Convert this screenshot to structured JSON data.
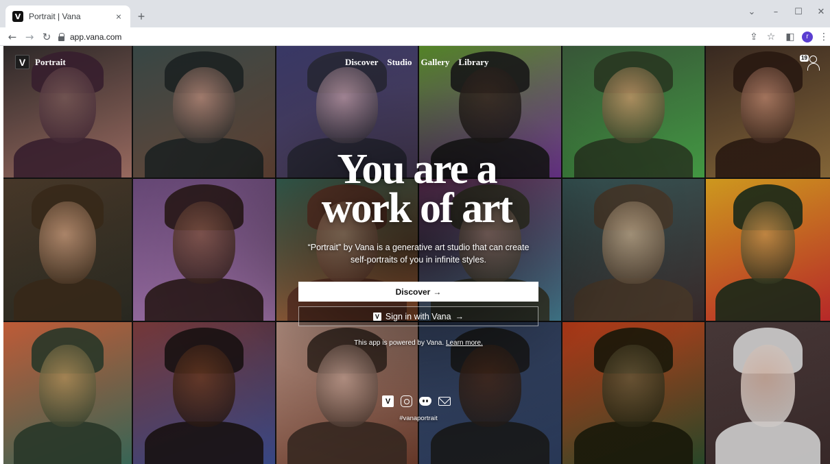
{
  "browser": {
    "tab_title": "Portrait | Vana",
    "tab_favicon": "V",
    "tab_close": "×",
    "new_tab": "+",
    "url": "app.vana.com",
    "profile_initial": "r",
    "controls": {
      "back": "←",
      "forward": "→",
      "reload": "↻",
      "minimize": "–",
      "maximize": "☐",
      "close": "✕",
      "tab_search": "⌄"
    },
    "toolbar_icons": {
      "share": "⇪",
      "bookmark": "☆",
      "sidepanel": "◧",
      "menu": "⋮"
    }
  },
  "header": {
    "logo_mark": "V",
    "brand": "Portrait",
    "nav": [
      "Discover",
      "Studio",
      "Gallery",
      "Library"
    ],
    "notification_count": "19"
  },
  "hero": {
    "title_line1": "You are a",
    "title_line2": "work of art",
    "subtitle_line1": "“Portrait” by Vana is a generative art studio that can create",
    "subtitle_line2": "self-portraits of you in infinite styles."
  },
  "cta": {
    "discover_label": "Discover",
    "discover_arrow": "→",
    "signin_label": "Sign in with Vana",
    "signin_arrow": "→",
    "signin_mark": "V"
  },
  "footer": {
    "powered_text": "This app is powered by Vana.",
    "learn_more": "Learn more.",
    "social_mark": "V",
    "hashtag": "#vanaportrait"
  },
  "colors": {
    "tiles": [
      [
        "#2f2a2a",
        "#7a5a58",
        "#3a2030",
        "#a06f64"
      ],
      [
        "#3a4a48",
        "#b88a7a",
        "#1e2424",
        "#6b4a3a"
      ],
      [
        "#3b3a6a",
        "#c8a3b0",
        "#2a2a38",
        "#5a4a6a"
      ],
      [
        "#5a8f2a",
        "#3a2a22",
        "#1a1a1a",
        "#7a3aa0"
      ],
      [
        "#3a5a3a",
        "#c89a6a",
        "#2a3a22",
        "#46a046"
      ],
      [
        "#3a2a22",
        "#b8826a",
        "#2a1a12",
        "#8a6a3a"
      ],
      [
        "#4a3a2a",
        "#c89a7a",
        "#3a2a1a",
        "#2a2a22"
      ],
      [
        "#6a4a7a",
        "#8a5a4a",
        "#2a1a18",
        "#a878b0"
      ],
      [
        "#3a6a5a",
        "#d8b090",
        "#6a3a2a",
        "#c86a3a"
      ],
      [
        "#7a3a6a",
        "#c8a090",
        "#3a3a2a",
        "#4a8aa0"
      ],
      [
        "#3a5a5a",
        "#c8b090",
        "#4a3a2a",
        "#3a2a2a"
      ],
      [
        "#d8a020",
        "#c8904a",
        "#1a2a1a",
        "#c02a2a"
      ],
      [
        "#c8603a",
        "#b0905a",
        "#2a3a2a",
        "#3a6a5a"
      ],
      [
        "#7a3a3a",
        "#6a3a22",
        "#1a1212",
        "#3a4a8a"
      ],
      [
        "#c8a090",
        "#d8b0a0",
        "#3a2a22",
        "#6a3a2a"
      ],
      [
        "#3a4a6a",
        "#4a2a1a",
        "#1a1a1a",
        "#2a3a5a"
      ],
      [
        "#c8401a",
        "#6a5a3a",
        "#1a1a0a",
        "#2a4a2a"
      ],
      [
        "#4a3a3a",
        "#d8b8a8",
        "#d8d8d8",
        "#3a2a2a"
      ]
    ]
  }
}
